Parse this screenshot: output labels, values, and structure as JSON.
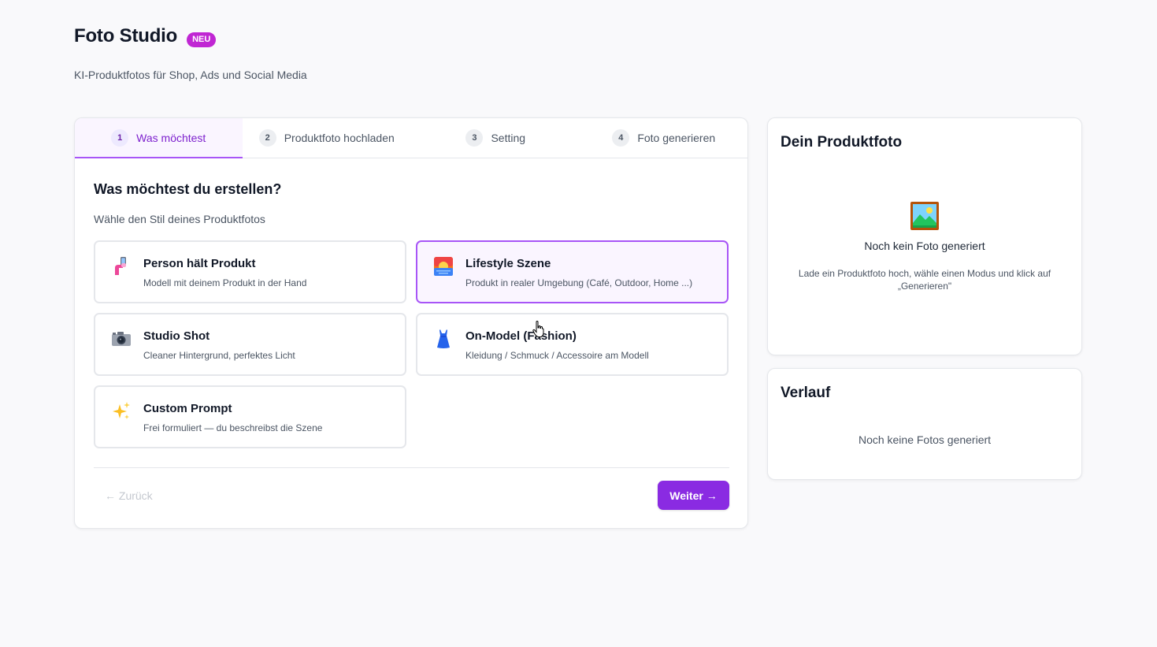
{
  "header": {
    "title": "Foto Studio",
    "badge": "NEU",
    "subtitle": "KI-Produktfotos für Shop, Ads und Social Media"
  },
  "wizard": {
    "tabs": [
      {
        "num": "1",
        "label": "Was möchtest",
        "active": true
      },
      {
        "num": "2",
        "label": "Produktfoto hochladen",
        "active": false
      },
      {
        "num": "3",
        "label": "Setting",
        "active": false
      },
      {
        "num": "4",
        "label": "Foto generieren",
        "active": false
      }
    ],
    "section_title": "Was möchtest du erstellen?",
    "section_subtitle": "Wähle den Stil deines Produktfotos",
    "options": [
      {
        "icon": "hand-holding-phone-icon",
        "title": "Person hält Produkt",
        "desc": "Modell mit deinem Produkt in der Hand",
        "selected": false
      },
      {
        "icon": "sunset-scene-icon",
        "title": "Lifestyle Szene",
        "desc": "Produkt in realer Umgebung (Café, Outdoor, Home ...)",
        "selected": true
      },
      {
        "icon": "camera-icon",
        "title": "Studio Shot",
        "desc": "Cleaner Hintergrund, perfektes Licht",
        "selected": false
      },
      {
        "icon": "dress-icon",
        "title": "On-Model (Fashion)",
        "desc": "Kleidung / Schmuck / Accessoire am Modell",
        "selected": false
      },
      {
        "icon": "sparkles-icon",
        "title": "Custom Prompt",
        "desc": "Frei formuliert — du beschreibst die Szene",
        "selected": false
      }
    ],
    "back_label": "← Zurück",
    "next_label": "Weiter →"
  },
  "preview": {
    "title": "Dein Produktfoto",
    "empty_icon": "framed-picture-icon",
    "empty_title": "Noch kein Foto generiert",
    "empty_desc": "Lade ein Produktfoto hoch, wähle einen Modus und klick auf „Generieren\""
  },
  "history": {
    "title": "Verlauf",
    "empty": "Noch keine Fotos generiert"
  },
  "colors": {
    "accent": "#8a2be2",
    "accent_light": "#faf5ff",
    "accent_border": "#a855f7",
    "badge": "#c026d3",
    "background": "#f9f9fb"
  }
}
